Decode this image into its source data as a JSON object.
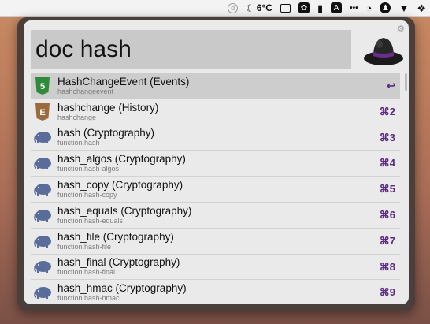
{
  "menubar": {
    "items": [
      "d-icon",
      "weather-icon",
      "temp",
      "window-icon",
      "flower-icon",
      "clipboard-icon",
      "translate-icon",
      "dots-icon",
      "clock-icon",
      "user-icon",
      "bookmark-icon",
      "dropbox-icon"
    ],
    "temperature": "6°C",
    "translate_label": "A",
    "dots_label": "•••"
  },
  "search": {
    "query": "doc hash"
  },
  "results": [
    {
      "title": "HashChangeEvent (Events)",
      "subtitle": "hashchangeevent",
      "shortcut": "↩",
      "icon": "html5-green-icon",
      "selected": true
    },
    {
      "title": "hashchange (History)",
      "subtitle": "hashchange",
      "shortcut": "⌘2",
      "icon": "html5-brown-icon"
    },
    {
      "title": "hash (Cryptography)",
      "subtitle": "function.hash",
      "shortcut": "⌘3",
      "icon": "php-elephant-icon"
    },
    {
      "title": "hash_algos (Cryptography)",
      "subtitle": "function.hash-algos",
      "shortcut": "⌘4",
      "icon": "php-elephant-icon"
    },
    {
      "title": "hash_copy (Cryptography)",
      "subtitle": "function.hash-copy",
      "shortcut": "⌘5",
      "icon": "php-elephant-icon"
    },
    {
      "title": "hash_equals (Cryptography)",
      "subtitle": "function.hash-equals",
      "shortcut": "⌘6",
      "icon": "php-elephant-icon"
    },
    {
      "title": "hash_file (Cryptography)",
      "subtitle": "function.hash-file",
      "shortcut": "⌘7",
      "icon": "php-elephant-icon"
    },
    {
      "title": "hash_final (Cryptography)",
      "subtitle": "function.hash-final",
      "shortcut": "⌘8",
      "icon": "php-elephant-icon"
    },
    {
      "title": "hash_hmac (Cryptography)",
      "subtitle": "function.hash-hmac",
      "shortcut": "⌘9",
      "icon": "php-elephant-icon"
    }
  ],
  "colors": {
    "accent": "#5b2b80",
    "selected_row": "#cdcdcd",
    "panel": "#eaeaea"
  }
}
